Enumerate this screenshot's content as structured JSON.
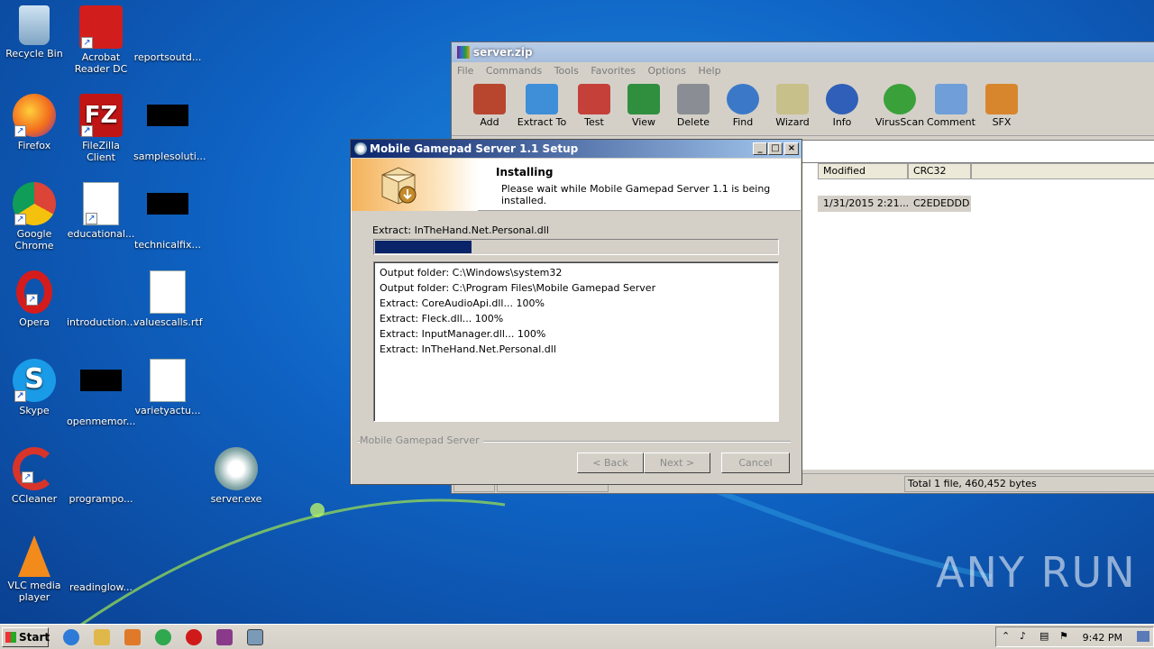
{
  "desktop": {
    "icons": [
      {
        "label": "Recycle Bin"
      },
      {
        "label": "Acrobat\nReader DC"
      },
      {
        "label": "reportsoutd..."
      },
      {
        "label": "Firefox"
      },
      {
        "label": "FileZilla Client"
      },
      {
        "label": "samplesoluti..."
      },
      {
        "label": "Google\nChrome"
      },
      {
        "label": "educational..."
      },
      {
        "label": "technicalfix..."
      },
      {
        "label": "Opera"
      },
      {
        "label": "introduction..."
      },
      {
        "label": "valuescalls.rtf"
      },
      {
        "label": "Skype"
      },
      {
        "label": "openmemor..."
      },
      {
        "label": "varietyactu..."
      },
      {
        "label": "CCleaner"
      },
      {
        "label": "programpo..."
      },
      {
        "label": "server.exe"
      },
      {
        "label": "VLC media\nplayer"
      },
      {
        "label": "readinglow..."
      }
    ]
  },
  "rar": {
    "title": "server.zip",
    "menu": [
      "File",
      "Commands",
      "Tools",
      "Favorites",
      "Options",
      "Help"
    ],
    "toolbar": [
      {
        "label": "Add",
        "color": "#b8462e"
      },
      {
        "label": "Extract To",
        "color": "#3f8fd8"
      },
      {
        "label": "Test",
        "color": "#c6403a"
      },
      {
        "label": "View",
        "color": "#2f8f3f"
      },
      {
        "label": "Delete",
        "color": "#8a8e94"
      },
      {
        "label": "Find",
        "color": "#3b78c8"
      },
      {
        "label": "Wizard",
        "color": "#c8c08a"
      },
      {
        "label": "Info",
        "color": "#2f5fb8"
      },
      {
        "label": "VirusScan",
        "color": "#3aa13a"
      },
      {
        "label": "Comment",
        "color": "#6f9ed8"
      },
      {
        "label": "SFX",
        "color": "#d8862e"
      }
    ],
    "columns": {
      "modified": "Modified",
      "crc": "CRC32"
    },
    "row": {
      "modified": "1/31/2015 2:21...",
      "crc": "C2EDEDDD"
    },
    "status": "Total 1 file, 460,452 bytes"
  },
  "setup": {
    "title": "Mobile Gamepad Server 1.1 Setup",
    "header_title": "Installing",
    "header_sub": "Please wait while Mobile Gamepad Server 1.1 is being installed.",
    "current": "Extract: InTheHand.Net.Personal.dll",
    "progress_percent": 24,
    "log": [
      "Output folder: C:\\Windows\\system32",
      "Output folder: C:\\Program Files\\Mobile Gamepad Server",
      "Extract: CoreAudioApi.dll... 100%",
      "Extract: Fleck.dll... 100%",
      "Extract: InputManager.dll... 100%",
      "Extract: InTheHand.Net.Personal.dll"
    ],
    "brand": "Mobile Gamepad Server",
    "buttons": {
      "back": "< Back",
      "next": "Next >",
      "cancel": "Cancel"
    }
  },
  "watermark": "ANY  RUN",
  "taskbar": {
    "start": "Start",
    "clock": "9:42 PM",
    "apps": [
      {
        "name": "ie",
        "color": "#2d7ad8"
      },
      {
        "name": "explorer",
        "color": "#e0b84a"
      },
      {
        "name": "media",
        "color": "#e07a2a"
      },
      {
        "name": "chrome",
        "color": "#2fa84f"
      },
      {
        "name": "opera",
        "color": "#d01a1a"
      },
      {
        "name": "winrar",
        "color": "#8a3a8a"
      },
      {
        "name": "setup",
        "color": "#7a9ab8"
      }
    ]
  }
}
